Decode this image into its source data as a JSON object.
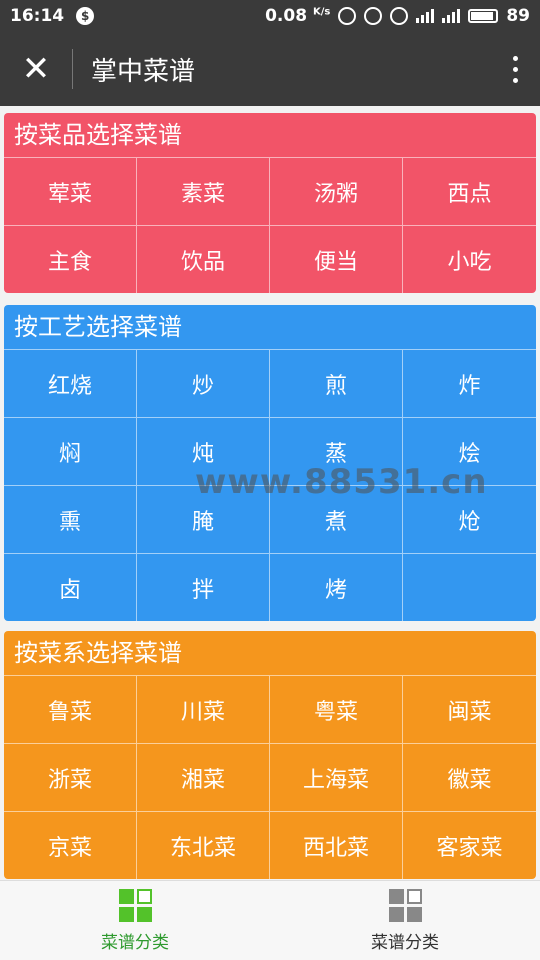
{
  "status_bar": {
    "time": "16:14",
    "notification_glyph": "$",
    "speed_value": "0.08",
    "speed_unit": "K/s",
    "battery": "89"
  },
  "app_bar": {
    "title": "掌中菜谱"
  },
  "sections": [
    {
      "title": "按菜品选择菜谱",
      "color": "#f25468",
      "items": [
        "荤菜",
        "素菜",
        "汤粥",
        "西点",
        "主食",
        "饮品",
        "便当",
        "小吃"
      ]
    },
    {
      "title": "按工艺选择菜谱",
      "color": "#3397f0",
      "items": [
        "红烧",
        "炒",
        "煎",
        "炸",
        "焖",
        "炖",
        "蒸",
        "烩",
        "熏",
        "腌",
        "煮",
        "炝",
        "卤",
        "拌",
        "烤",
        ""
      ]
    },
    {
      "title": "按菜系选择菜谱",
      "color": "#f5961d",
      "items": [
        "鲁菜",
        "川菜",
        "粤菜",
        "闽菜",
        "浙菜",
        "湘菜",
        "上海菜",
        "徽菜",
        "京菜",
        "东北菜",
        "西北菜",
        "客家菜"
      ]
    }
  ],
  "watermark": "www.88531.cn",
  "bottom_nav": [
    {
      "label": "菜谱分类",
      "active": true,
      "icon": "grid-icon"
    },
    {
      "label": "菜谱分类",
      "active": false,
      "icon": "grid-icon"
    }
  ]
}
